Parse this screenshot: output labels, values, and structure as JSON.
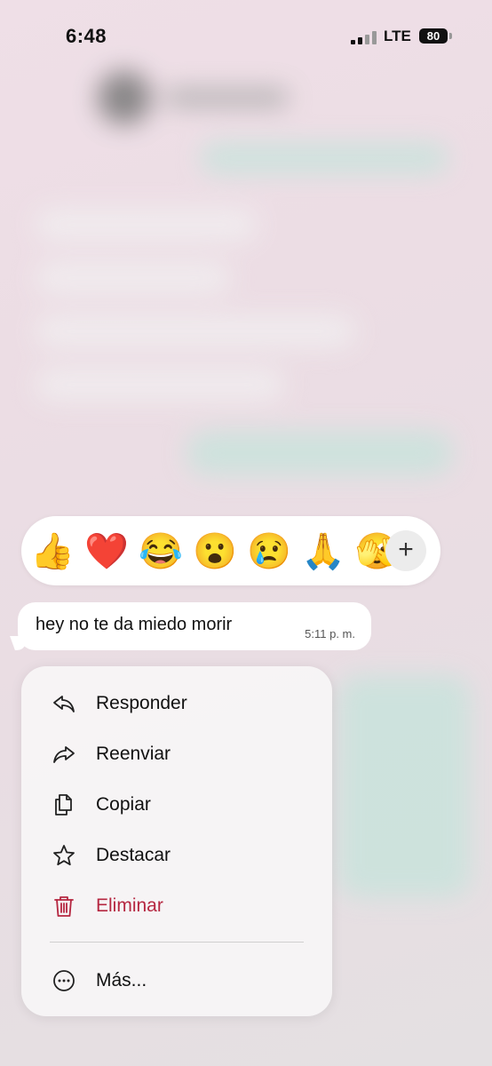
{
  "status_bar": {
    "time": "6:48",
    "network": "LTE",
    "battery": "80"
  },
  "reactions": {
    "emojis": [
      "👍",
      "❤️",
      "😂",
      "😮",
      "😢",
      "🙏",
      "🫣"
    ],
    "more_label": "+"
  },
  "message": {
    "text": "hey no te da miedo morir",
    "time": "5:11 p. m."
  },
  "menu": {
    "items": [
      {
        "label": "Responder",
        "icon": "reply-icon"
      },
      {
        "label": "Reenviar",
        "icon": "forward-icon"
      },
      {
        "label": "Copiar",
        "icon": "copy-icon"
      },
      {
        "label": "Destacar",
        "icon": "star-icon"
      },
      {
        "label": "Eliminar",
        "icon": "trash-icon",
        "color": "#b52640"
      },
      {
        "label": "Más...",
        "icon": "more-icon"
      }
    ]
  }
}
